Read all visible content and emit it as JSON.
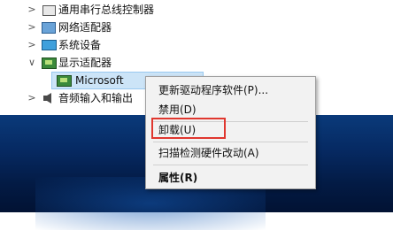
{
  "tree": {
    "items": [
      {
        "label": "通用串行总线控制器",
        "chevron": ">",
        "icon": "usb-controller-icon"
      },
      {
        "label": "网络适配器",
        "chevron": ">",
        "icon": "network-adapter-icon"
      },
      {
        "label": "系统设备",
        "chevron": ">",
        "icon": "system-devices-icon"
      },
      {
        "label": "显示适配器",
        "chevron": "∨",
        "icon": "display-adapter-icon"
      },
      {
        "label": "音频输入和输出",
        "chevron": ">",
        "icon": "audio-icon"
      }
    ],
    "child": {
      "label": "Microsoft",
      "icon": "display-adapter-icon"
    }
  },
  "context_menu": {
    "items": [
      {
        "label": "更新驱动程序软件(P)..."
      },
      {
        "label": "禁用(D)"
      },
      {
        "label": "卸载(U)"
      },
      {
        "label": "扫描检测硬件改动(A)"
      },
      {
        "label": "属性(R)"
      }
    ]
  },
  "colors": {
    "highlight_border": "#e0372f",
    "selection_bg": "#cce4f7",
    "desktop_bg": "#062a63"
  }
}
